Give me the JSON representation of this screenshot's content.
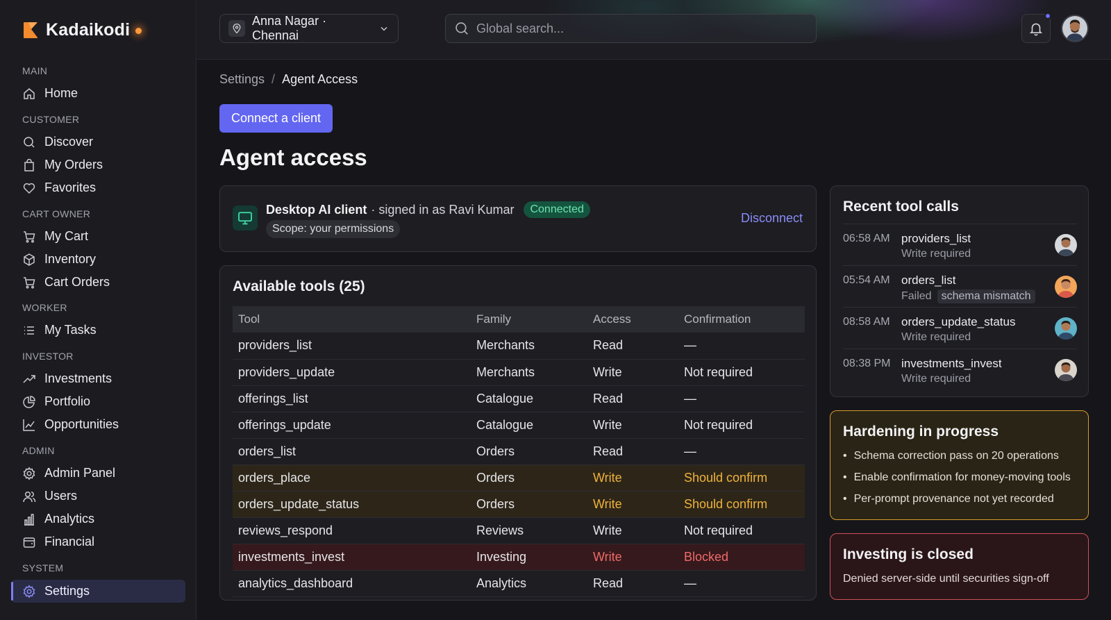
{
  "brand": {
    "name": "Kadaikodi"
  },
  "sidebar": {
    "sections": [
      {
        "label": "MAIN",
        "items": [
          {
            "label": "Home",
            "icon": "home-icon"
          }
        ]
      },
      {
        "label": "CUSTOMER",
        "items": [
          {
            "label": "Discover",
            "icon": "search-icon"
          },
          {
            "label": "My Orders",
            "icon": "shopping-bag-icon"
          },
          {
            "label": "Favorites",
            "icon": "heart-icon"
          }
        ]
      },
      {
        "label": "CART OWNER",
        "items": [
          {
            "label": "My Cart",
            "icon": "cart-icon"
          },
          {
            "label": "Inventory",
            "icon": "box-icon"
          },
          {
            "label": "Cart Orders",
            "icon": "cart-icon"
          }
        ]
      },
      {
        "label": "WORKER",
        "items": [
          {
            "label": "My Tasks",
            "icon": "task-list-icon"
          }
        ]
      },
      {
        "label": "INVESTOR",
        "items": [
          {
            "label": "Investments",
            "icon": "trending-up-icon"
          },
          {
            "label": "Portfolio",
            "icon": "pie-chart-icon"
          },
          {
            "label": "Opportunities",
            "icon": "line-chart-icon"
          }
        ]
      },
      {
        "label": "ADMIN",
        "items": [
          {
            "label": "Admin Panel",
            "icon": "gear-icon"
          },
          {
            "label": "Users",
            "icon": "users-icon"
          },
          {
            "label": "Analytics",
            "icon": "bar-chart-icon"
          },
          {
            "label": "Financial",
            "icon": "wallet-icon"
          }
        ]
      },
      {
        "label": "SYSTEM",
        "items": [
          {
            "label": "Settings",
            "icon": "gear-icon",
            "active": true
          }
        ]
      }
    ]
  },
  "header": {
    "location": "Anna Nagar · Chennai",
    "search_placeholder": "Global search..."
  },
  "breadcrumb": {
    "parent": "Settings",
    "separator": "/",
    "current": "Agent Access"
  },
  "main": {
    "connect_button": "Connect a client",
    "title": "Agent access"
  },
  "client": {
    "name": "Desktop AI client",
    "signed_in": "· signed in as Ravi Kumar",
    "status": "Connected",
    "scope": "Scope: your permissions",
    "disconnect": "Disconnect"
  },
  "tools": {
    "title": "Available tools (25)",
    "columns": [
      "Tool",
      "Family",
      "Access",
      "Confirmation"
    ],
    "rows": [
      {
        "tool": "providers_list",
        "family": "Merchants",
        "access": "Read",
        "confirmation": "—",
        "level": "normal"
      },
      {
        "tool": "providers_update",
        "family": "Merchants",
        "access": "Write",
        "confirmation": "Not required",
        "level": "normal"
      },
      {
        "tool": "offerings_list",
        "family": "Catalogue",
        "access": "Read",
        "confirmation": "—",
        "level": "normal"
      },
      {
        "tool": "offerings_update",
        "family": "Catalogue",
        "access": "Write",
        "confirmation": "Not required",
        "level": "normal"
      },
      {
        "tool": "orders_list",
        "family": "Orders",
        "access": "Read",
        "confirmation": "—",
        "level": "normal"
      },
      {
        "tool": "orders_place",
        "family": "Orders",
        "access": "Write",
        "confirmation": "Should confirm",
        "level": "warn"
      },
      {
        "tool": "orders_update_status",
        "family": "Orders",
        "access": "Write",
        "confirmation": "Should confirm",
        "level": "warn"
      },
      {
        "tool": "reviews_respond",
        "family": "Reviews",
        "access": "Write",
        "confirmation": "Not required",
        "level": "normal"
      },
      {
        "tool": "investments_invest",
        "family": "Investing",
        "access": "Write",
        "confirmation": "Blocked",
        "level": "danger"
      },
      {
        "tool": "analytics_dashboard",
        "family": "Analytics",
        "access": "Read",
        "confirmation": "—",
        "level": "normal"
      }
    ]
  },
  "recent": {
    "title": "Recent tool calls",
    "items": [
      {
        "time": "06:58 AM",
        "name": "providers_list",
        "status": "Write required",
        "chip": ""
      },
      {
        "time": "05:54 AM",
        "name": "orders_list",
        "status": "Failed",
        "chip": "schema mismatch"
      },
      {
        "time": "08:58 AM",
        "name": "orders_update_status",
        "status": "Write required",
        "chip": ""
      },
      {
        "time": "08:38 PM",
        "name": "investments_invest",
        "status": "Write required",
        "chip": ""
      }
    ]
  },
  "hardening": {
    "title": "Hardening in progress",
    "items": [
      "Schema correction pass on 20 operations",
      "Enable confirmation for money-moving tools",
      "Per-prompt provenance not yet recorded"
    ]
  },
  "closed": {
    "title": "Investing is closed",
    "text": "Denied server-side until securities sign-off"
  },
  "colors": {
    "accent": "#6366f1",
    "connected": "#6fe3b2",
    "warning": "#f0b23c",
    "danger": "#f06a6a"
  }
}
